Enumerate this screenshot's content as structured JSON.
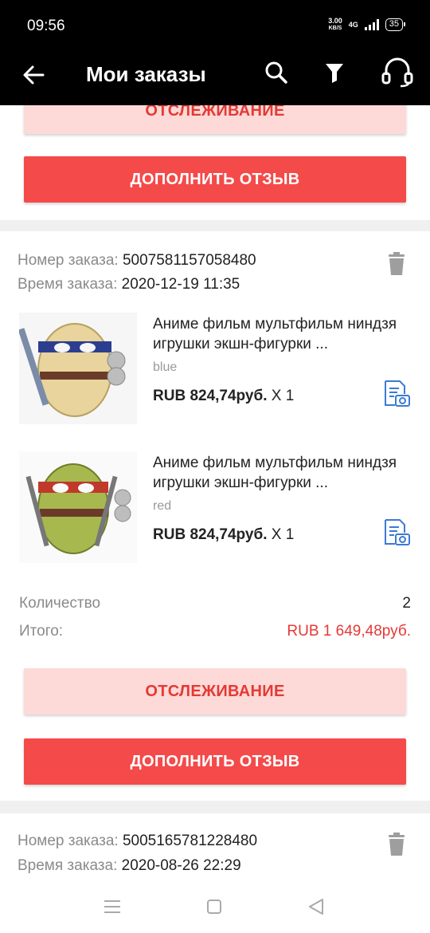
{
  "status": {
    "time": "09:56",
    "speed_top": "3.00",
    "speed_unit": "KB/S",
    "network": "4G",
    "battery": "35"
  },
  "appbar": {
    "title": "Мои заказы"
  },
  "labels": {
    "track": "ОТСЛЕЖИВАНИЕ",
    "review": "ДОПОЛНИТЬ ОТЗЫВ",
    "order_number": "Номер заказа:",
    "order_time": "Время заказа:",
    "quantity": "Количество",
    "total": "Итого:"
  },
  "orders": [
    {
      "number": "5007581157058480",
      "time": "2020-12-19 11:35",
      "items": [
        {
          "name": "Аниме фильм мультфильм ниндзя игрушки экшн-фигурки ...",
          "variant": "blue",
          "price": "RUB 824,74руб.",
          "qty": "X 1"
        },
        {
          "name": "Аниме фильм мультфильм ниндзя игрушки экшн-фигурки ...",
          "variant": "red",
          "price": "RUB 824,74руб.",
          "qty": "X 1"
        }
      ],
      "quantity": "2",
      "total": "RUB 1 649,48руб."
    },
    {
      "number": "5005165781228480",
      "time": "2020-08-26 22:29"
    }
  ],
  "colors": {
    "accent": "#f44a4a",
    "track_bg": "#fddad7",
    "price_red": "#e53935",
    "icon_blue": "#3a7bd5"
  }
}
